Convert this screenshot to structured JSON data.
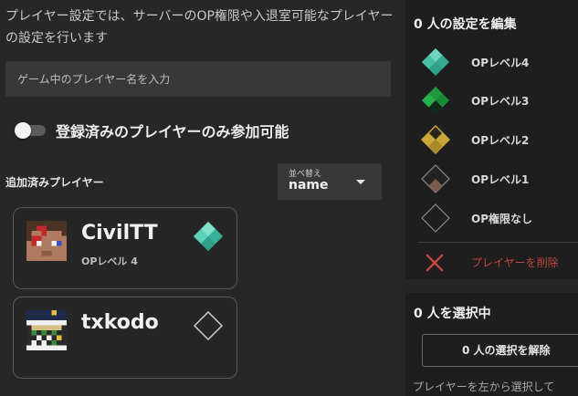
{
  "left_panel": {
    "description": "プレイヤー設定では、サーバーのOP権限や入退室可能なプレイヤーの設定を行います",
    "search": {
      "placeholder": "ゲーム中のプレイヤー名を入力",
      "value": ""
    },
    "whitelist_toggle": {
      "label": "登録済みのプレイヤーのみ参加可能",
      "enabled": false
    },
    "added_players_label": "追加済みプレイヤー",
    "sort": {
      "caption": "並べ替え",
      "value": "name"
    },
    "players": [
      {
        "name": "CivilTT",
        "level_text": "OPレベル 4",
        "op_level": 4
      },
      {
        "name": "txkodo",
        "level_text": "",
        "op_level": 0
      }
    ]
  },
  "edit_panel": {
    "title": "0 人の設定を編集",
    "options": [
      {
        "label": "OPレベル4",
        "icon": "diamond-teal-icon"
      },
      {
        "label": "OPレベル3",
        "icon": "diamond-green-icon"
      },
      {
        "label": "OPレベル2",
        "icon": "diamond-gold-icon"
      },
      {
        "label": "OPレベル1",
        "icon": "diamond-brown-icon"
      },
      {
        "label": "OP権限なし",
        "icon": "diamond-outline-icon"
      }
    ],
    "delete_label": "プレイヤーを削除"
  },
  "selection_panel": {
    "title": "0 人を選択中",
    "deselect_button": "0 人の選択を解除",
    "hint": "プレイヤーを左から選択して"
  },
  "colors": {
    "op4": "#46c8ad",
    "op3": "#1f9b3f",
    "op2": "#c9a83a",
    "op1": "#7a5a4a",
    "danger": "#c2453f"
  }
}
